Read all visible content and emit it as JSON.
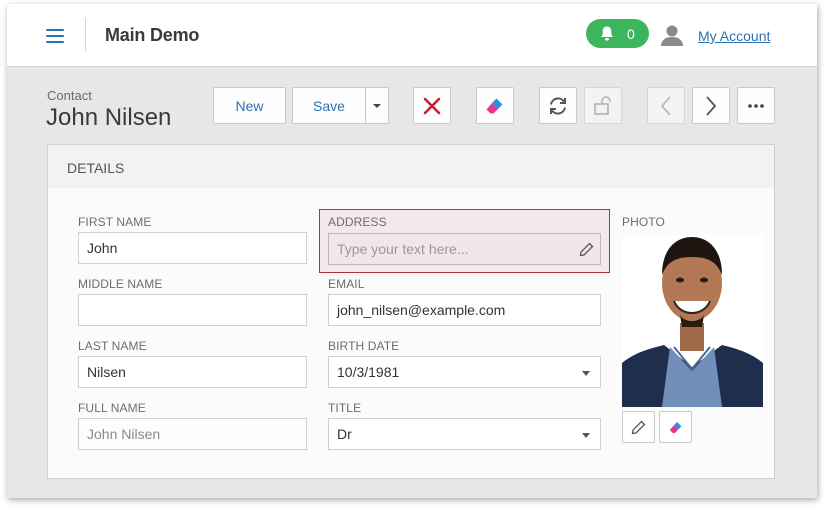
{
  "header": {
    "app_title": "Main Demo",
    "notifications_count": "0",
    "account_link": "My Account",
    "accent_color": "#2b73b8",
    "notif_color": "#3db55c"
  },
  "toolbar": {
    "breadcrumb": "Contact",
    "title": "John Nilsen",
    "new_label": "New",
    "save_label": "Save"
  },
  "details": {
    "section_title": "DETAILS",
    "first_name": {
      "label": "FIRST NAME",
      "value": "John"
    },
    "middle_name": {
      "label": "MIDDLE NAME",
      "value": ""
    },
    "last_name": {
      "label": "LAST NAME",
      "value": "Nilsen"
    },
    "full_name": {
      "label": "FULL NAME",
      "value": "John Nilsen"
    },
    "address": {
      "label": "ADDRESS",
      "placeholder": "Type your text here..."
    },
    "email": {
      "label": "EMAIL",
      "value": "john_nilsen@example.com"
    },
    "birth_date": {
      "label": "BIRTH DATE",
      "value": "10/3/1981"
    },
    "title_field": {
      "label": "TITLE",
      "value": "Dr"
    },
    "photo": {
      "label": "PHOTO"
    }
  },
  "icons": {
    "menu": "hamburger-icon",
    "bell": "bell-icon",
    "user": "user-icon",
    "delete": "close-icon",
    "clear": "eraser-icon",
    "refresh": "refresh-icon",
    "unlock": "unlock-icon",
    "prev": "chevron-left-icon",
    "next": "chevron-right-icon",
    "more": "ellipsis-icon",
    "edit": "pencil-icon"
  }
}
